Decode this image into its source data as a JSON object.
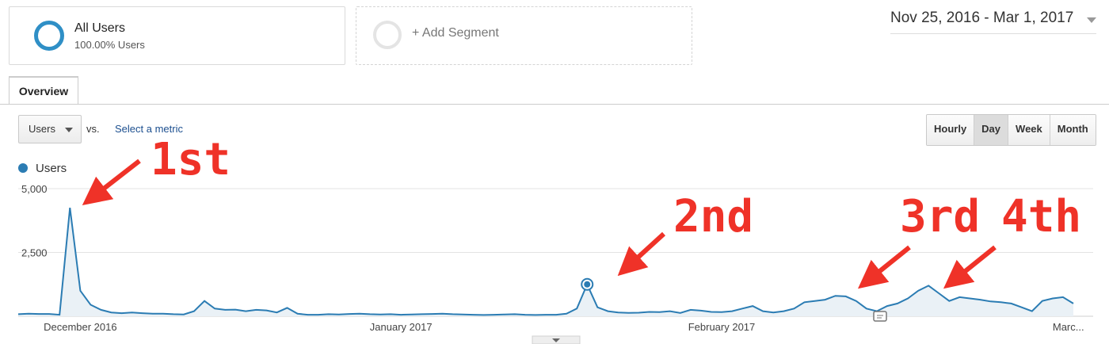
{
  "segments": {
    "all_users": {
      "title": "All Users",
      "subtitle": "100.00% Users"
    },
    "add_segment": {
      "label": "+ Add Segment"
    }
  },
  "date_range": "Nov 25, 2016 - Mar 1, 2017",
  "tabs": {
    "overview": "Overview"
  },
  "metric": {
    "selected": "Users",
    "vs": "vs.",
    "select_metric": "Select a metric"
  },
  "granularity": {
    "options": [
      "Hourly",
      "Day",
      "Week",
      "Month"
    ],
    "active": "Day"
  },
  "legend": {
    "series": "Users",
    "color": "#2b7cb3"
  },
  "annotations": [
    "1st",
    "2nd",
    "3rd",
    "4th"
  ],
  "colors": {
    "line": "#2b7cb3",
    "fill": "#eaf1f6",
    "annotation": "#ef3228"
  },
  "chart_data": {
    "type": "area",
    "series": [
      {
        "name": "Users",
        "values": [
          80,
          100,
          90,
          90,
          60,
          4250,
          1000,
          450,
          250,
          150,
          120,
          150,
          120,
          100,
          100,
          80,
          70,
          200,
          600,
          300,
          250,
          260,
          200,
          250,
          230,
          150,
          330,
          100,
          60,
          60,
          80,
          70,
          90,
          100,
          80,
          70,
          80,
          60,
          70,
          80,
          90,
          100,
          80,
          70,
          60,
          50,
          60,
          70,
          80,
          60,
          50,
          60,
          60,
          100,
          300,
          1250,
          350,
          200,
          150,
          130,
          140,
          170,
          160,
          200,
          130,
          250,
          220,
          170,
          160,
          200,
          300,
          400,
          200,
          150,
          200,
          300,
          550,
          600,
          650,
          800,
          780,
          600,
          300,
          200,
          400,
          500,
          700,
          1000,
          1200,
          900,
          600,
          750,
          700,
          650,
          580,
          550,
          500,
          350,
          200,
          600,
          700,
          750,
          500
        ]
      }
    ],
    "y_ticks": [
      "5,000",
      "2,500"
    ],
    "x_labels": [
      "December 2016",
      "January 2017",
      "February 2017",
      "Marc..."
    ],
    "ylim": [
      0,
      5000
    ],
    "grid": true,
    "legend": "top-left",
    "highlight_index": 55
  }
}
